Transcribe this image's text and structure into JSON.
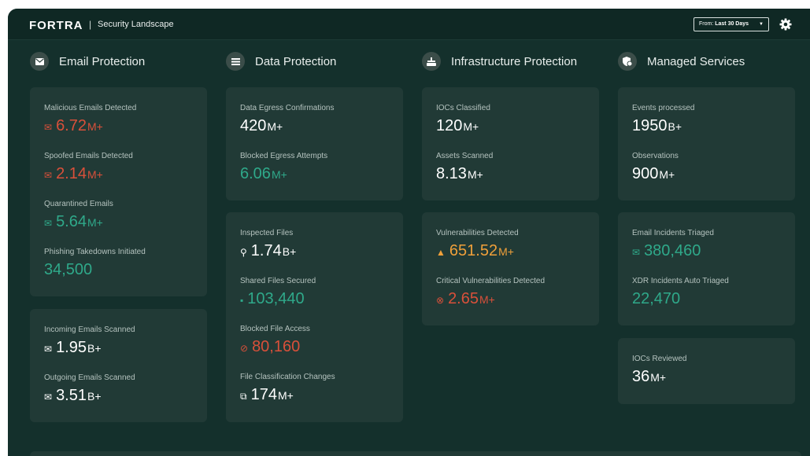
{
  "header": {
    "brand": "FORTRA",
    "separator": "|",
    "subtitle": "Security Landscape",
    "range_prefix": "From:",
    "range_value": "Last 30 Days"
  },
  "colors": {
    "red": "#d9503a",
    "green": "#2fa98a",
    "white": "#ffffff",
    "orange": "#f0a03a",
    "panel": "#213a36",
    "background": "#14302c"
  },
  "sections": {
    "email": {
      "title": "Email Protection",
      "icon": "envelope-icon"
    },
    "data": {
      "title": "Data Protection",
      "icon": "list-icon"
    },
    "infra": {
      "title": "Infrastructure Protection",
      "icon": "server-icon"
    },
    "managed": {
      "title": "Managed Services",
      "icon": "shield-gear-icon"
    }
  },
  "email": {
    "malicious": {
      "label": "Malicious Emails Detected",
      "value": "6.72",
      "suffix": "M+"
    },
    "spoofed": {
      "label": "Spoofed Emails Detected",
      "value": "2.14",
      "suffix": "M+"
    },
    "quarantined": {
      "label": "Quarantined Emails",
      "value": "5.64",
      "suffix": "M+"
    },
    "phishing": {
      "label": "Phishing Takedowns Initiated",
      "value": "34,500"
    },
    "incoming": {
      "label": "Incoming Emails Scanned",
      "value": "1.95",
      "suffix": "B+"
    },
    "outgoing": {
      "label": "Outgoing Emails Scanned",
      "value": "3.51",
      "suffix": "B+"
    }
  },
  "data": {
    "egress": {
      "label": "Data Egress Confirmations",
      "value": "420",
      "suffix": "M+"
    },
    "blocked_egress": {
      "label": "Blocked Egress Attempts",
      "value": "6.06",
      "suffix": "M+"
    },
    "inspected": {
      "label": "Inspected Files",
      "value": "1.74",
      "suffix": "B+"
    },
    "shared": {
      "label": "Shared Files Secured",
      "value": "103,440"
    },
    "blocked_access": {
      "label": "Blocked File Access",
      "value": "80,160"
    },
    "classification": {
      "label": "File Classification Changes",
      "value": "174",
      "suffix": "M+"
    }
  },
  "infra": {
    "iocs": {
      "label": "IOCs Classified",
      "value": "120",
      "suffix": "M+"
    },
    "assets": {
      "label": "Assets Scanned",
      "value": "8.13",
      "suffix": "M+"
    },
    "vulns": {
      "label": "Vulnerabilities Detected",
      "value": "651.52",
      "suffix": "M+"
    },
    "critical": {
      "label": "Critical Vulnerabilities Detected",
      "value": "2.65",
      "suffix": "M+"
    }
  },
  "managed": {
    "events": {
      "label": "Events processed",
      "value": "1950",
      "suffix": "B+"
    },
    "observations": {
      "label": "Observations",
      "value": "900",
      "suffix": "M+"
    },
    "email_triaged": {
      "label": "Email Incidents Triaged",
      "value": "380,460"
    },
    "xdr": {
      "label": "XDR Incidents Auto Triaged",
      "value": "22,470"
    },
    "iocs_reviewed": {
      "label": "IOCs Reviewed",
      "value": "36",
      "suffix": "M+"
    }
  }
}
